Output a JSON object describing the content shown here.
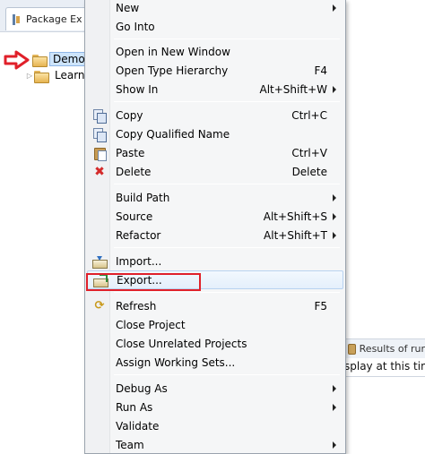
{
  "explorer": {
    "tab_label": "Package Ex",
    "tree": [
      {
        "label": "Demo",
        "selected": true
      },
      {
        "label": "Learn-",
        "selected": false
      }
    ]
  },
  "results_panel": {
    "tab_label": "Results of rur",
    "text": "splay at this time"
  },
  "context_menu": {
    "new": {
      "label": "New"
    },
    "go_into": {
      "label": "Go Into"
    },
    "open_new_window": {
      "label": "Open in New Window"
    },
    "open_type_hierarchy": {
      "label": "Open Type Hierarchy",
      "shortcut": "F4"
    },
    "show_in": {
      "label": "Show In",
      "shortcut": "Alt+Shift+W"
    },
    "copy": {
      "label": "Copy",
      "shortcut": "Ctrl+C"
    },
    "copy_qualified_name": {
      "label": "Copy Qualified Name"
    },
    "paste": {
      "label": "Paste",
      "shortcut": "Ctrl+V"
    },
    "delete": {
      "label": "Delete",
      "shortcut": "Delete"
    },
    "build_path": {
      "label": "Build Path"
    },
    "source": {
      "label": "Source",
      "shortcut": "Alt+Shift+S"
    },
    "refactor": {
      "label": "Refactor",
      "shortcut": "Alt+Shift+T"
    },
    "import": {
      "label": "Import..."
    },
    "export": {
      "label": "Export..."
    },
    "refresh": {
      "label": "Refresh",
      "shortcut": "F5"
    },
    "close_project": {
      "label": "Close Project"
    },
    "close_unrelated_projects": {
      "label": "Close Unrelated Projects"
    },
    "assign_working_sets": {
      "label": "Assign Working Sets..."
    },
    "debug_as": {
      "label": "Debug As"
    },
    "run_as": {
      "label": "Run As"
    },
    "validate": {
      "label": "Validate"
    },
    "team": {
      "label": "Team"
    }
  },
  "colors": {
    "highlight_red": "#e0202a",
    "selection_blue": "#cde4fb",
    "menu_background": "#f5f6f7"
  }
}
